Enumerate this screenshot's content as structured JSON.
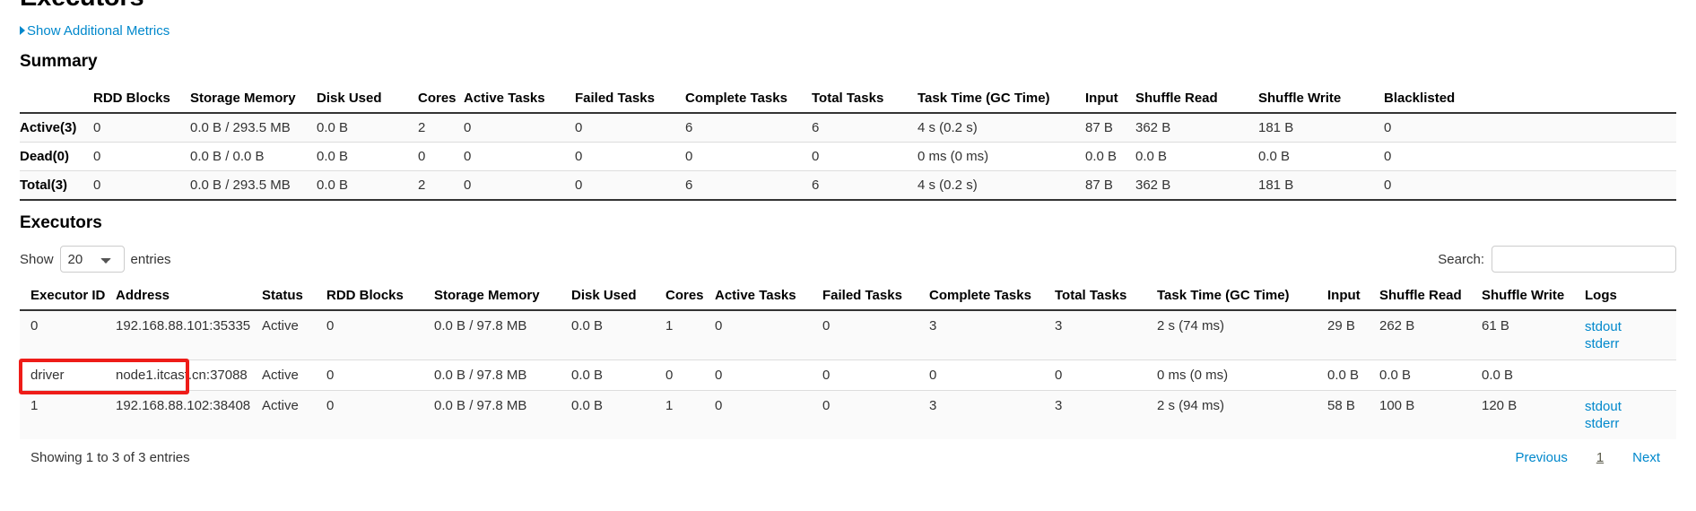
{
  "page": {
    "title": "Executors",
    "show_metrics_link": "Show Additional Metrics",
    "summary_heading": "Summary",
    "executors_heading": "Executors"
  },
  "summary_table": {
    "columns": [
      "",
      "RDD Blocks",
      "Storage Memory",
      "Disk Used",
      "Cores",
      "Active Tasks",
      "Failed Tasks",
      "Complete Tasks",
      "Total Tasks",
      "Task Time (GC Time)",
      "Input",
      "Shuffle Read",
      "Shuffle Write",
      "Blacklisted"
    ],
    "rows": [
      {
        "label": "Active(3)",
        "rdd_blocks": "0",
        "storage_memory": "0.0 B / 293.5 MB",
        "disk_used": "0.0 B",
        "cores": "2",
        "active_tasks": "0",
        "failed_tasks": "0",
        "complete_tasks": "6",
        "total_tasks": "6",
        "task_time": "4 s (0.2 s)",
        "input": "87 B",
        "shuffle_read": "362 B",
        "shuffle_write": "181 B",
        "blacklisted": "0"
      },
      {
        "label": "Dead(0)",
        "rdd_blocks": "0",
        "storage_memory": "0.0 B / 0.0 B",
        "disk_used": "0.0 B",
        "cores": "0",
        "active_tasks": "0",
        "failed_tasks": "0",
        "complete_tasks": "0",
        "total_tasks": "0",
        "task_time": "0 ms (0 ms)",
        "input": "0.0 B",
        "shuffle_read": "0.0 B",
        "shuffle_write": "0.0 B",
        "blacklisted": "0"
      },
      {
        "label": "Total(3)",
        "rdd_blocks": "0",
        "storage_memory": "0.0 B / 293.5 MB",
        "disk_used": "0.0 B",
        "cores": "2",
        "active_tasks": "0",
        "failed_tasks": "0",
        "complete_tasks": "6",
        "total_tasks": "6",
        "task_time": "4 s (0.2 s)",
        "input": "87 B",
        "shuffle_read": "362 B",
        "shuffle_write": "181 B",
        "blacklisted": "0"
      }
    ]
  },
  "controls": {
    "show_label": "Show",
    "entries_label": "entries",
    "page_length_value": "20",
    "page_length_options": [
      "20"
    ],
    "search_label": "Search:",
    "search_value": "",
    "search_placeholder": ""
  },
  "executors_table": {
    "columns": [
      "Executor ID",
      "Address",
      "Status",
      "RDD Blocks",
      "Storage Memory",
      "Disk Used",
      "Cores",
      "Active Tasks",
      "Failed Tasks",
      "Complete Tasks",
      "Total Tasks",
      "Task Time (GC Time)",
      "Input",
      "Shuffle Read",
      "Shuffle Write",
      "Logs"
    ],
    "rows": [
      {
        "executor_id": "0",
        "address": "192.168.88.101:35335",
        "status": "Active",
        "rdd_blocks": "0",
        "storage_memory": "0.0 B / 97.8 MB",
        "disk_used": "0.0 B",
        "cores": "1",
        "active_tasks": "0",
        "failed_tasks": "0",
        "complete_tasks": "3",
        "total_tasks": "3",
        "task_time": "2 s (74 ms)",
        "input": "29 B",
        "shuffle_read": "262 B",
        "shuffle_write": "61 B",
        "logs": [
          "stdout",
          "stderr"
        ]
      },
      {
        "executor_id": "driver",
        "address": "node1.itcast.cn:37088",
        "status": "Active",
        "rdd_blocks": "0",
        "storage_memory": "0.0 B / 97.8 MB",
        "disk_used": "0.0 B",
        "cores": "0",
        "active_tasks": "0",
        "failed_tasks": "0",
        "complete_tasks": "0",
        "total_tasks": "0",
        "task_time": "0 ms (0 ms)",
        "input": "0.0 B",
        "shuffle_read": "0.0 B",
        "shuffle_write": "0.0 B",
        "logs": []
      },
      {
        "executor_id": "1",
        "address": "192.168.88.102:38408",
        "status": "Active",
        "rdd_blocks": "0",
        "storage_memory": "0.0 B / 97.8 MB",
        "disk_used": "0.0 B",
        "cores": "1",
        "active_tasks": "0",
        "failed_tasks": "0",
        "complete_tasks": "3",
        "total_tasks": "3",
        "task_time": "2 s (94 ms)",
        "input": "58 B",
        "shuffle_read": "100 B",
        "shuffle_write": "120 B",
        "logs": [
          "stdout",
          "stderr"
        ]
      }
    ]
  },
  "footer": {
    "info": "Showing 1 to 3 of 3 entries",
    "previous": "Previous",
    "current_page": "1",
    "next": "Next"
  },
  "annotation": {
    "color": "#ee1c18"
  }
}
